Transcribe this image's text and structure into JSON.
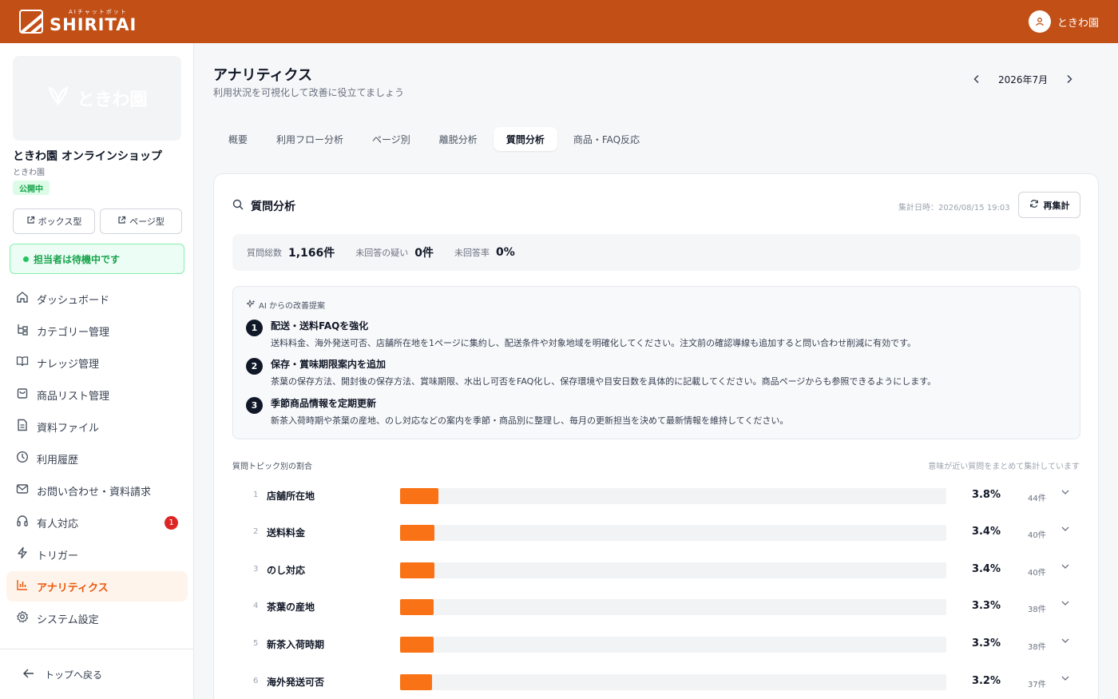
{
  "header": {
    "logo_sub": "AIチャットボット",
    "logo_main": "SHIRITAI",
    "user_name": "ときわ園",
    "user_icon": "user-icon"
  },
  "sidebar": {
    "shop_image_text": "ときわ園",
    "shop_name": "ときわ園 オンラインショップ",
    "shop_sub": "ときわ園",
    "status": "公開中",
    "box_type_label": "ボックス型",
    "page_type_label": "ページ型",
    "agent_status": "担当者は待機中です",
    "items": [
      {
        "label": "ダッシュボード",
        "icon": "home-icon"
      },
      {
        "label": "カテゴリー管理",
        "icon": "category-icon"
      },
      {
        "label": "ナレッジ管理",
        "icon": "book-icon"
      },
      {
        "label": "商品リスト管理",
        "icon": "bag-icon"
      },
      {
        "label": "資料ファイル",
        "icon": "file-icon"
      },
      {
        "label": "利用履歴",
        "icon": "clock-icon"
      },
      {
        "label": "お問い合わせ・資料請求",
        "icon": "mail-icon"
      },
      {
        "label": "有人対応",
        "icon": "headset-icon",
        "badge": "1"
      },
      {
        "label": "トリガー",
        "icon": "bolt-icon"
      },
      {
        "label": "アナリティクス",
        "icon": "chart-icon",
        "active": true
      },
      {
        "label": "システム設定",
        "icon": "gear-icon"
      }
    ],
    "back_label": "トップへ戻る"
  },
  "page": {
    "title": "アナリティクス",
    "subtitle": "利用状況を可視化して改善に役立てましょう",
    "month": "2026年7月"
  },
  "tabs": [
    {
      "label": "概要"
    },
    {
      "label": "利用フロー分析"
    },
    {
      "label": "ページ別"
    },
    {
      "label": "離脱分析"
    },
    {
      "label": "質問分析",
      "active": true
    },
    {
      "label": "商品・FAQ反応"
    }
  ],
  "card": {
    "title": "質問分析",
    "agg_time": "集計日時：2026/08/15 19:03",
    "refresh_label": "再集計",
    "stats": [
      {
        "label": "質問総数",
        "value": "1,166件"
      },
      {
        "label": "未回答の疑い",
        "value": "0件"
      },
      {
        "label": "未回答率",
        "value": "0%"
      }
    ],
    "ai_label": "AI からの改善提案",
    "suggestions": [
      {
        "num": "1",
        "title": "配送・送料FAQを強化",
        "desc": "送料料金、海外発送可否、店舗所在地を1ページに集約し、配送条件や対象地域を明確化してください。注文前の確認導線も追加すると問い合わせ削減に有効です。"
      },
      {
        "num": "2",
        "title": "保存・賞味期限案内を追加",
        "desc": "茶葉の保存方法、開封後の保存方法、賞味期限、水出し可否をFAQ化し、保存環境や目安日数を具体的に記載してください。商品ページからも参照できるようにします。"
      },
      {
        "num": "3",
        "title": "季節商品情報を定期更新",
        "desc": "新茶入荷時期や茶葉の産地、のし対応などの案内を季節・商品別に整理し、毎月の更新担当を決めて最新情報を維持してください。"
      }
    ],
    "topic_label": "質問トピック別の割合",
    "topic_note": "意味が近い質問をまとめて集計しています",
    "topics": [
      {
        "rank": "1",
        "name": "店舗所在地",
        "pct": "3.8%",
        "value": 3.8,
        "count": "44件"
      },
      {
        "rank": "2",
        "name": "送料料金",
        "pct": "3.4%",
        "value": 3.4,
        "count": "40件"
      },
      {
        "rank": "3",
        "name": "のし対応",
        "pct": "3.4%",
        "value": 3.4,
        "count": "40件"
      },
      {
        "rank": "4",
        "name": "茶葉の産地",
        "pct": "3.3%",
        "value": 3.3,
        "count": "38件"
      },
      {
        "rank": "5",
        "name": "新茶入荷時期",
        "pct": "3.3%",
        "value": 3.3,
        "count": "38件"
      },
      {
        "rank": "6",
        "name": "海外発送可否",
        "pct": "3.2%",
        "value": 3.2,
        "count": "37件"
      }
    ]
  },
  "colors": {
    "brand": "#c24f16",
    "accent": "#f97316",
    "active_nav_bg": "#fff4eb",
    "status_green": "#16a34a",
    "badge_red": "#dc2626"
  }
}
